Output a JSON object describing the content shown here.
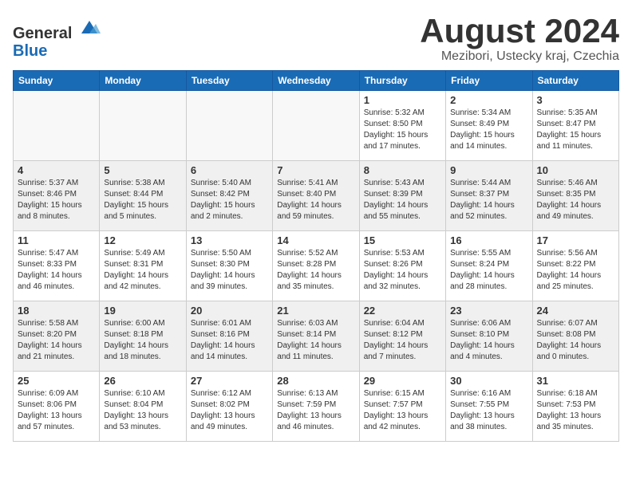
{
  "header": {
    "logo": {
      "line1": "General",
      "line2": "Blue"
    },
    "title": "August 2024",
    "subtitle": "Mezibori, Ustecky kraj, Czechia"
  },
  "weekdays": [
    "Sunday",
    "Monday",
    "Tuesday",
    "Wednesday",
    "Thursday",
    "Friday",
    "Saturday"
  ],
  "weeks": [
    [
      {
        "day": "",
        "info": ""
      },
      {
        "day": "",
        "info": ""
      },
      {
        "day": "",
        "info": ""
      },
      {
        "day": "",
        "info": ""
      },
      {
        "day": "1",
        "info": "Sunrise: 5:32 AM\nSunset: 8:50 PM\nDaylight: 15 hours\nand 17 minutes."
      },
      {
        "day": "2",
        "info": "Sunrise: 5:34 AM\nSunset: 8:49 PM\nDaylight: 15 hours\nand 14 minutes."
      },
      {
        "day": "3",
        "info": "Sunrise: 5:35 AM\nSunset: 8:47 PM\nDaylight: 15 hours\nand 11 minutes."
      }
    ],
    [
      {
        "day": "4",
        "info": "Sunrise: 5:37 AM\nSunset: 8:46 PM\nDaylight: 15 hours\nand 8 minutes."
      },
      {
        "day": "5",
        "info": "Sunrise: 5:38 AM\nSunset: 8:44 PM\nDaylight: 15 hours\nand 5 minutes."
      },
      {
        "day": "6",
        "info": "Sunrise: 5:40 AM\nSunset: 8:42 PM\nDaylight: 15 hours\nand 2 minutes."
      },
      {
        "day": "7",
        "info": "Sunrise: 5:41 AM\nSunset: 8:40 PM\nDaylight: 14 hours\nand 59 minutes."
      },
      {
        "day": "8",
        "info": "Sunrise: 5:43 AM\nSunset: 8:39 PM\nDaylight: 14 hours\nand 55 minutes."
      },
      {
        "day": "9",
        "info": "Sunrise: 5:44 AM\nSunset: 8:37 PM\nDaylight: 14 hours\nand 52 minutes."
      },
      {
        "day": "10",
        "info": "Sunrise: 5:46 AM\nSunset: 8:35 PM\nDaylight: 14 hours\nand 49 minutes."
      }
    ],
    [
      {
        "day": "11",
        "info": "Sunrise: 5:47 AM\nSunset: 8:33 PM\nDaylight: 14 hours\nand 46 minutes."
      },
      {
        "day": "12",
        "info": "Sunrise: 5:49 AM\nSunset: 8:31 PM\nDaylight: 14 hours\nand 42 minutes."
      },
      {
        "day": "13",
        "info": "Sunrise: 5:50 AM\nSunset: 8:30 PM\nDaylight: 14 hours\nand 39 minutes."
      },
      {
        "day": "14",
        "info": "Sunrise: 5:52 AM\nSunset: 8:28 PM\nDaylight: 14 hours\nand 35 minutes."
      },
      {
        "day": "15",
        "info": "Sunrise: 5:53 AM\nSunset: 8:26 PM\nDaylight: 14 hours\nand 32 minutes."
      },
      {
        "day": "16",
        "info": "Sunrise: 5:55 AM\nSunset: 8:24 PM\nDaylight: 14 hours\nand 28 minutes."
      },
      {
        "day": "17",
        "info": "Sunrise: 5:56 AM\nSunset: 8:22 PM\nDaylight: 14 hours\nand 25 minutes."
      }
    ],
    [
      {
        "day": "18",
        "info": "Sunrise: 5:58 AM\nSunset: 8:20 PM\nDaylight: 14 hours\nand 21 minutes."
      },
      {
        "day": "19",
        "info": "Sunrise: 6:00 AM\nSunset: 8:18 PM\nDaylight: 14 hours\nand 18 minutes."
      },
      {
        "day": "20",
        "info": "Sunrise: 6:01 AM\nSunset: 8:16 PM\nDaylight: 14 hours\nand 14 minutes."
      },
      {
        "day": "21",
        "info": "Sunrise: 6:03 AM\nSunset: 8:14 PM\nDaylight: 14 hours\nand 11 minutes."
      },
      {
        "day": "22",
        "info": "Sunrise: 6:04 AM\nSunset: 8:12 PM\nDaylight: 14 hours\nand 7 minutes."
      },
      {
        "day": "23",
        "info": "Sunrise: 6:06 AM\nSunset: 8:10 PM\nDaylight: 14 hours\nand 4 minutes."
      },
      {
        "day": "24",
        "info": "Sunrise: 6:07 AM\nSunset: 8:08 PM\nDaylight: 14 hours\nand 0 minutes."
      }
    ],
    [
      {
        "day": "25",
        "info": "Sunrise: 6:09 AM\nSunset: 8:06 PM\nDaylight: 13 hours\nand 57 minutes."
      },
      {
        "day": "26",
        "info": "Sunrise: 6:10 AM\nSunset: 8:04 PM\nDaylight: 13 hours\nand 53 minutes."
      },
      {
        "day": "27",
        "info": "Sunrise: 6:12 AM\nSunset: 8:02 PM\nDaylight: 13 hours\nand 49 minutes."
      },
      {
        "day": "28",
        "info": "Sunrise: 6:13 AM\nSunset: 7:59 PM\nDaylight: 13 hours\nand 46 minutes."
      },
      {
        "day": "29",
        "info": "Sunrise: 6:15 AM\nSunset: 7:57 PM\nDaylight: 13 hours\nand 42 minutes."
      },
      {
        "day": "30",
        "info": "Sunrise: 6:16 AM\nSunset: 7:55 PM\nDaylight: 13 hours\nand 38 minutes."
      },
      {
        "day": "31",
        "info": "Sunrise: 6:18 AM\nSunset: 7:53 PM\nDaylight: 13 hours\nand 35 minutes."
      }
    ]
  ]
}
